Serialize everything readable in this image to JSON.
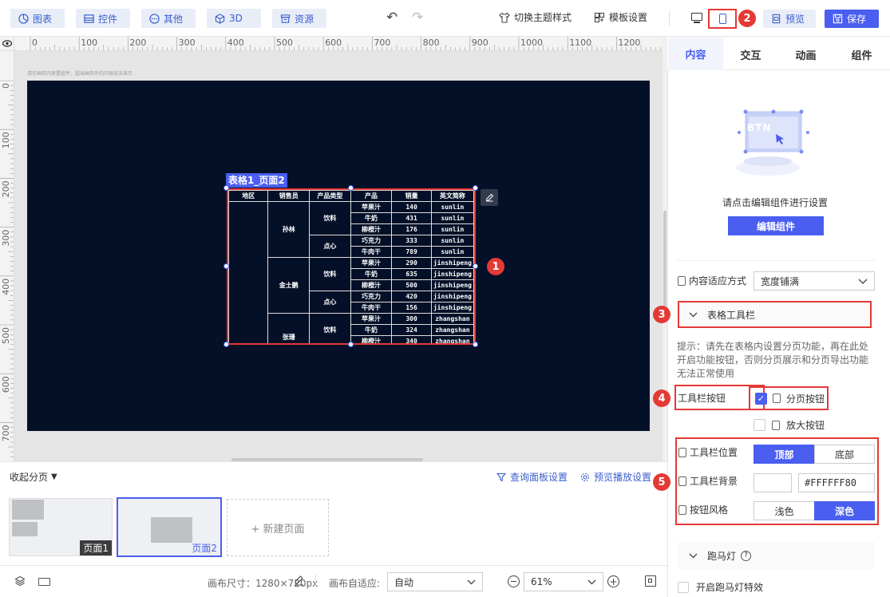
{
  "toolbar": {
    "chart_label": "图表",
    "control_label": "控件",
    "other_label": "其他",
    "three_d_label": "3D",
    "resource_label": "资源",
    "theme_label": "切换主题样式",
    "template_label": "模板设置",
    "preview_label": "预览",
    "save_label": "保存"
  },
  "ruler": {
    "h_ticks": [
      "0",
      "100",
      "200",
      "300",
      "400",
      "500",
      "600",
      "700",
      "800",
      "900",
      "1000",
      "1100",
      "1200"
    ],
    "v_ticks": [
      "0",
      "100",
      "200",
      "300",
      "400",
      "500",
      "600",
      "700"
    ]
  },
  "canvas": {
    "hint": "请在画布内放置组件，超出画布外的内容无法显示",
    "component_label": "表格1_页面2"
  },
  "table": {
    "headers": [
      "地区",
      "销售员",
      "产品类型",
      "产品",
      "销量",
      "英文简称"
    ],
    "sales": [
      "孙林",
      "金士鹏",
      "张珊"
    ],
    "types": [
      "饮料",
      "点心",
      "饮料",
      "点心",
      "饮料"
    ],
    "rows": [
      [
        "苹果汁",
        "140",
        "sunlin"
      ],
      [
        "牛奶",
        "431",
        "sunlin"
      ],
      [
        "柳橙汁",
        "176",
        "sunlin"
      ],
      [
        "巧克力",
        "333",
        "sunlin"
      ],
      [
        "牛肉干",
        "789",
        "sunlin"
      ],
      [
        "苹果汁",
        "290",
        "jinshipeng"
      ],
      [
        "牛奶",
        "635",
        "jinshipeng"
      ],
      [
        "柳橙汁",
        "500",
        "jinshipeng"
      ],
      [
        "巧克力",
        "420",
        "jinshipeng"
      ],
      [
        "牛肉干",
        "156",
        "jinshipeng"
      ],
      [
        "苹果汁",
        "300",
        "zhangshan"
      ],
      [
        "牛奶",
        "324",
        "zhangshan"
      ],
      [
        "柳橙汁",
        "340",
        "zhangshan"
      ]
    ]
  },
  "markers": [
    "1",
    "2",
    "3",
    "4",
    "5"
  ],
  "bottom": {
    "collapse_label": "收起分页",
    "query_label": "查询面板设置",
    "preview_settings_label": "预览播放设置",
    "page1": "页面1",
    "page2": "页面2",
    "new_page": "+ 新建页面",
    "size_label": "画布尺寸：1280×720px",
    "adapt_label": "画布自适应:",
    "adapt_value": "自动",
    "zoom_value": "61%"
  },
  "panel": {
    "tabs": [
      "内容",
      "交互",
      "动画",
      "组件"
    ],
    "illus_text": "BTN",
    "hint": "请点击编辑组件进行设置",
    "edit_button": "编辑组件",
    "fit_label": "内容适应方式",
    "fit_value": "宽度铺满",
    "toolbar_section": "表格工具栏",
    "tip": "提示：请先在表格内设置分页功能，再在此处开启功能按钮，否则分页展示和分页导出功能无法正常使用",
    "toolbar_buttons_label": "工具栏按钮",
    "page_button": "分页按钮",
    "zoom_button": "放大按钮",
    "position_label": "工具栏位置",
    "pos_top": "顶部",
    "pos_bottom": "底部",
    "bg_label": "工具栏背景",
    "bg_value": "#FFFFFF80",
    "style_label": "按钮风格",
    "style_light": "浅色",
    "style_dark": "深色",
    "marquee_section": "跑马灯",
    "marquee_enable": "开启跑马灯特效"
  },
  "colors": {
    "accent": "#4a5ef0",
    "dark_canvas": "#031027",
    "marker": "#e53935"
  }
}
